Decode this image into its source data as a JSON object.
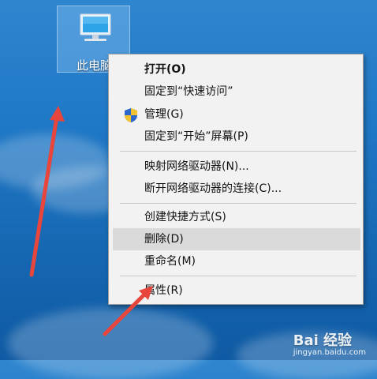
{
  "desktop": {
    "icon_label": "此电脑"
  },
  "context_menu": {
    "items": [
      {
        "label": "打开(O)",
        "bold": true
      },
      {
        "label": "固定到“快速访问”"
      },
      {
        "label": "管理(G)",
        "icon": "uac-shield-icon"
      },
      {
        "label": "固定到“开始”屏幕(P)"
      },
      {
        "label": "映射网络驱动器(N)..."
      },
      {
        "label": "断开网络驱动器的连接(C)..."
      },
      {
        "label": "创建快捷方式(S)"
      },
      {
        "label": "删除(D)",
        "highlighted": true
      },
      {
        "label": "重命名(M)"
      },
      {
        "label": "属性(R)"
      }
    ]
  },
  "watermark": {
    "brand": "Bai 经验",
    "url": "jingyan.baidu.com"
  },
  "colors": {
    "annotation_arrow": "#e8453c",
    "menu_background": "#f2f2f2",
    "menu_highlight": "#dadada"
  }
}
